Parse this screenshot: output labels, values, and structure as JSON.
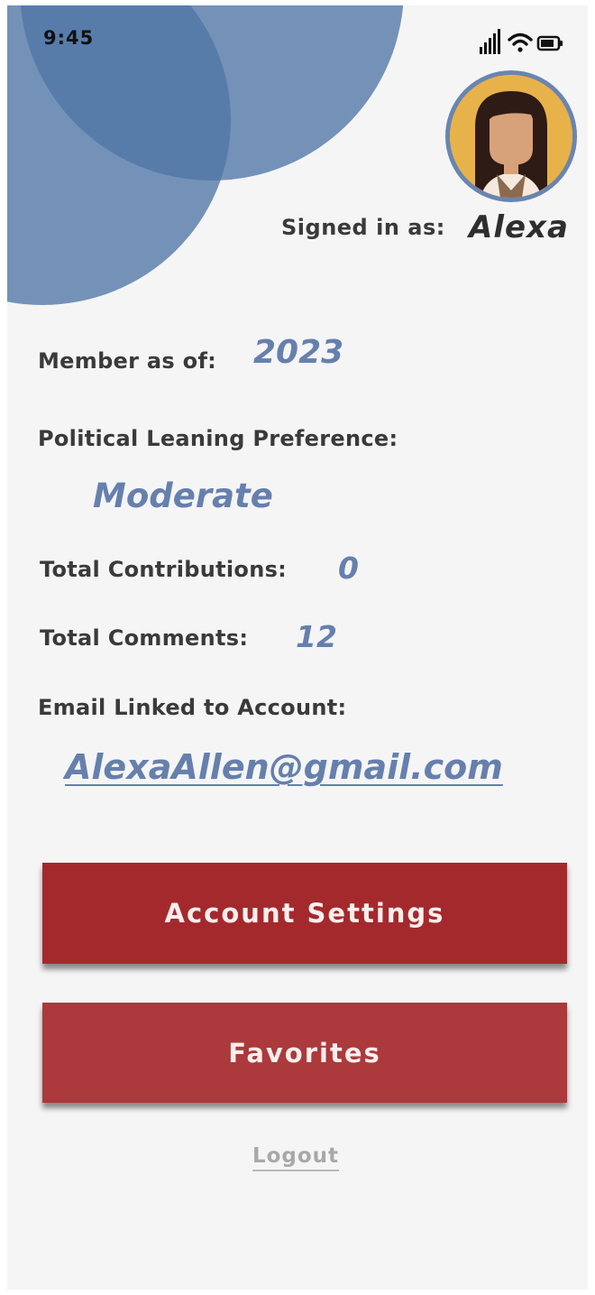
{
  "status_bar": {
    "time": "9:45",
    "icons": [
      "signal-icon",
      "wifi-icon",
      "battery-icon"
    ]
  },
  "profile": {
    "signed_in_label": "Signed in as:",
    "username": "Alexa",
    "avatar": "avatar-woman-long-dark-hair"
  },
  "details": {
    "member_label": "Member as of:",
    "member_value": "2023",
    "leaning_label": "Political Leaning Preference:",
    "leaning_value": "Moderate",
    "contributions_label": "Total Contributions:",
    "contributions_value": "0",
    "comments_label": "Total Comments:",
    "comments_value": "12",
    "email_label": "Email Linked to Account:",
    "email_value": "AlexaAllen@gmail.com"
  },
  "buttons": {
    "account_settings": "Account Settings",
    "favorites": "Favorites"
  },
  "logout_label": "Logout",
  "colors": {
    "header_circle": "#5076a6",
    "value_text": "#6680ad",
    "primary_button": "#a4292c",
    "secondary_button": "#ac393b",
    "background": "#f5f5f6",
    "avatar_bg": "#e8b24a"
  }
}
